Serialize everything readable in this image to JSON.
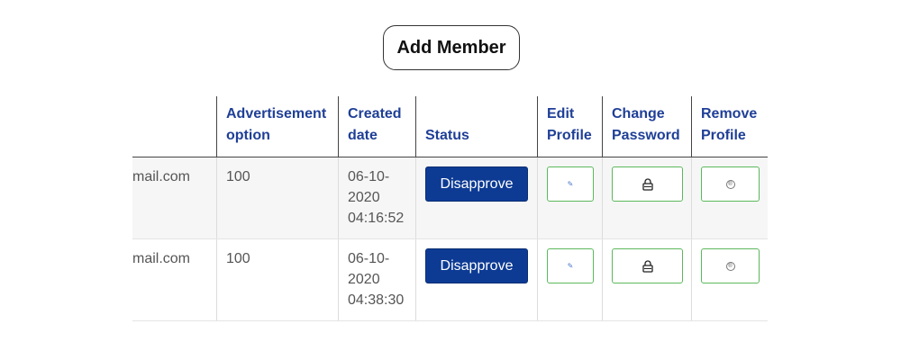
{
  "add_member_label": "Add Member",
  "table": {
    "headers": {
      "advertisement": "Advertisement option",
      "created": "Created date",
      "status": "Status",
      "edit": "Edit Profile",
      "change_password": "Change Password",
      "remove": "Remove Profile"
    },
    "rows": [
      {
        "email": "mail.com",
        "advertisement": "100",
        "date": "06-10-",
        "year": "2020",
        "time": "04:16:52",
        "status_label": "Disapprove"
      },
      {
        "email": "mail.com",
        "advertisement": "100",
        "date": "06-10-",
        "year": "2020",
        "time": "04:38:30",
        "status_label": "Disapprove"
      }
    ]
  },
  "icons": {
    "edit": "pencil-icon",
    "change_password": "lock-icon",
    "remove": "remove-icon"
  },
  "colors": {
    "header_text": "#1f3f97",
    "status_button": "#0d3b94",
    "action_border": "#5cb85c"
  }
}
